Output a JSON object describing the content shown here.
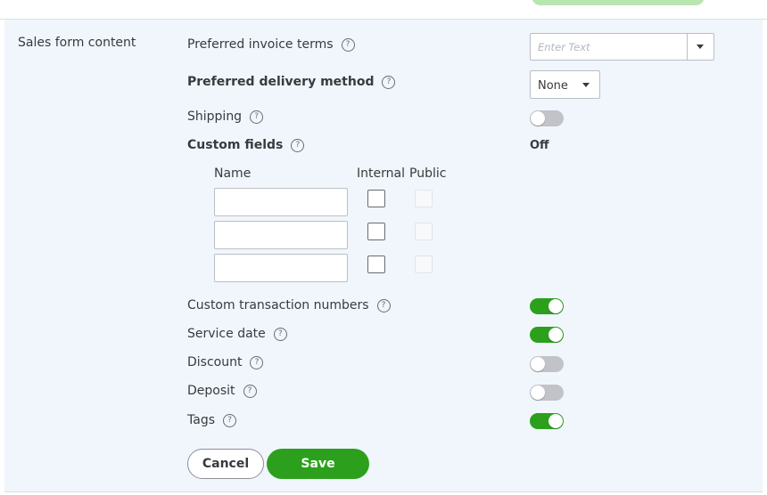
{
  "section": {
    "title": "Sales form content"
  },
  "settings": {
    "invoice_terms": {
      "label": "Preferred invoice terms",
      "placeholder": "Enter Text"
    },
    "delivery_method": {
      "label": "Preferred delivery method",
      "value": "None"
    },
    "shipping": {
      "label": "Shipping",
      "enabled": false
    },
    "custom_fields": {
      "label": "Custom fields",
      "status": "Off",
      "columns": {
        "name": "Name",
        "internal": "Internal",
        "public": "Public"
      },
      "rows": [
        {
          "name": "",
          "internal": false,
          "public": false
        },
        {
          "name": "",
          "internal": false,
          "public": false
        },
        {
          "name": "",
          "internal": false,
          "public": false
        }
      ]
    },
    "custom_transaction_numbers": {
      "label": "Custom transaction numbers",
      "enabled": true
    },
    "service_date": {
      "label": "Service date",
      "enabled": true
    },
    "discount": {
      "label": "Discount",
      "enabled": false
    },
    "deposit": {
      "label": "Deposit",
      "enabled": false
    },
    "tags": {
      "label": "Tags",
      "enabled": true
    }
  },
  "help_glyph": "?",
  "actions": {
    "cancel": "Cancel",
    "save": "Save"
  },
  "colors": {
    "accent": "#2ca01c",
    "toggle_off": "#c1c3c8",
    "panel_bg": "#f0f6fc",
    "text": "#393a3d"
  },
  "icons": {
    "help": "question-circle-icon",
    "dropdown": "chevron-down-icon"
  }
}
